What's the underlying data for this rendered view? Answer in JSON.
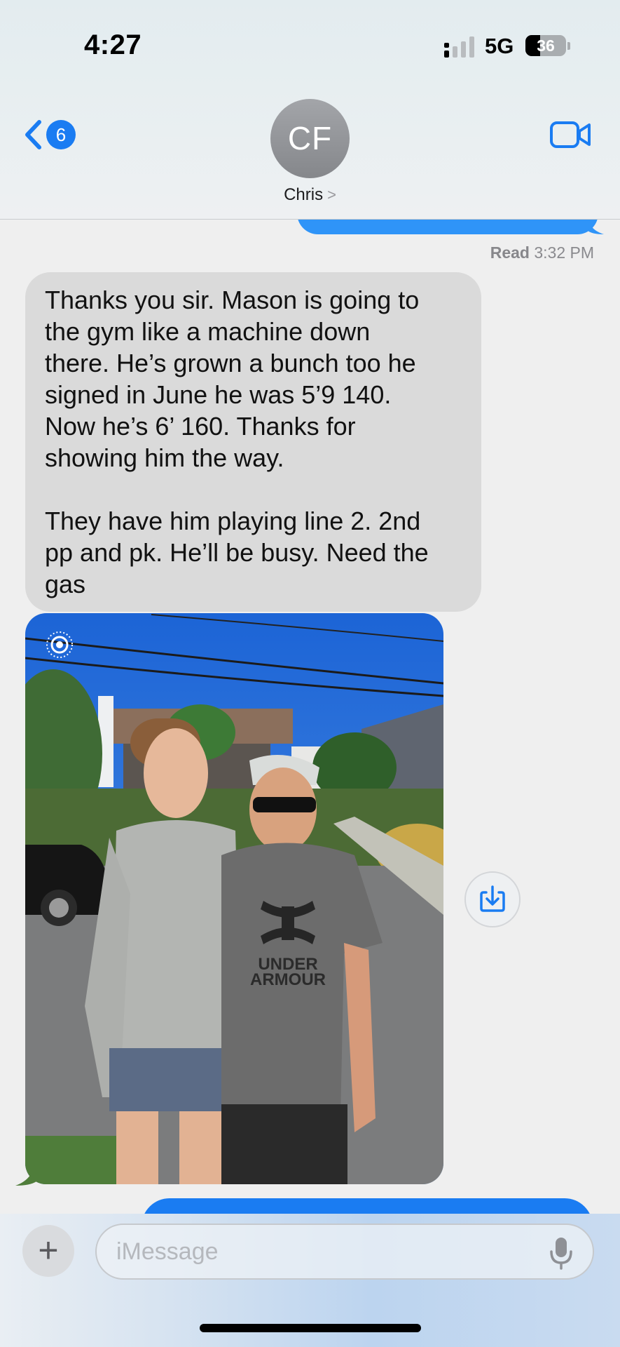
{
  "status_bar": {
    "time": "4:27",
    "network": "5G",
    "battery_label": "36",
    "battery_percent": 36
  },
  "header": {
    "back_badge": "6",
    "avatar_initials": "CF",
    "contact_name": "Chris",
    "contact_chevron": ">"
  },
  "conversation": {
    "read_label": "Read",
    "read_time": "3:32 PM",
    "incoming_message": {
      "paragraph_1_lines": [
        "Thanks you sir. Mason is going to",
        "the gym like a machine down",
        "there. He’s grown a bunch too he",
        "signed in June he was 5’9 140.",
        "Now he’s 6’ 160. Thanks for",
        "showing him the way."
      ],
      "paragraph_2_lines": [
        "They have him playing line 2. 2nd",
        "pp and pk. He’ll be busy. Need the",
        "gas"
      ]
    },
    "photo_shirt_text": [
      "UNDER",
      "ARMOUR"
    ]
  },
  "input_bar": {
    "plus_label": "+",
    "placeholder": "iMessage"
  },
  "colors": {
    "accent": "#1a7cf2",
    "incoming_bubble": "#dadada",
    "outgoing_bubble": "#2f94f8",
    "avatar": "#96989c"
  },
  "icons": [
    "signal-icon",
    "battery-icon",
    "back-chevron-icon",
    "video-camera-icon",
    "live-photo-icon",
    "save-download-icon",
    "mic-icon"
  ]
}
